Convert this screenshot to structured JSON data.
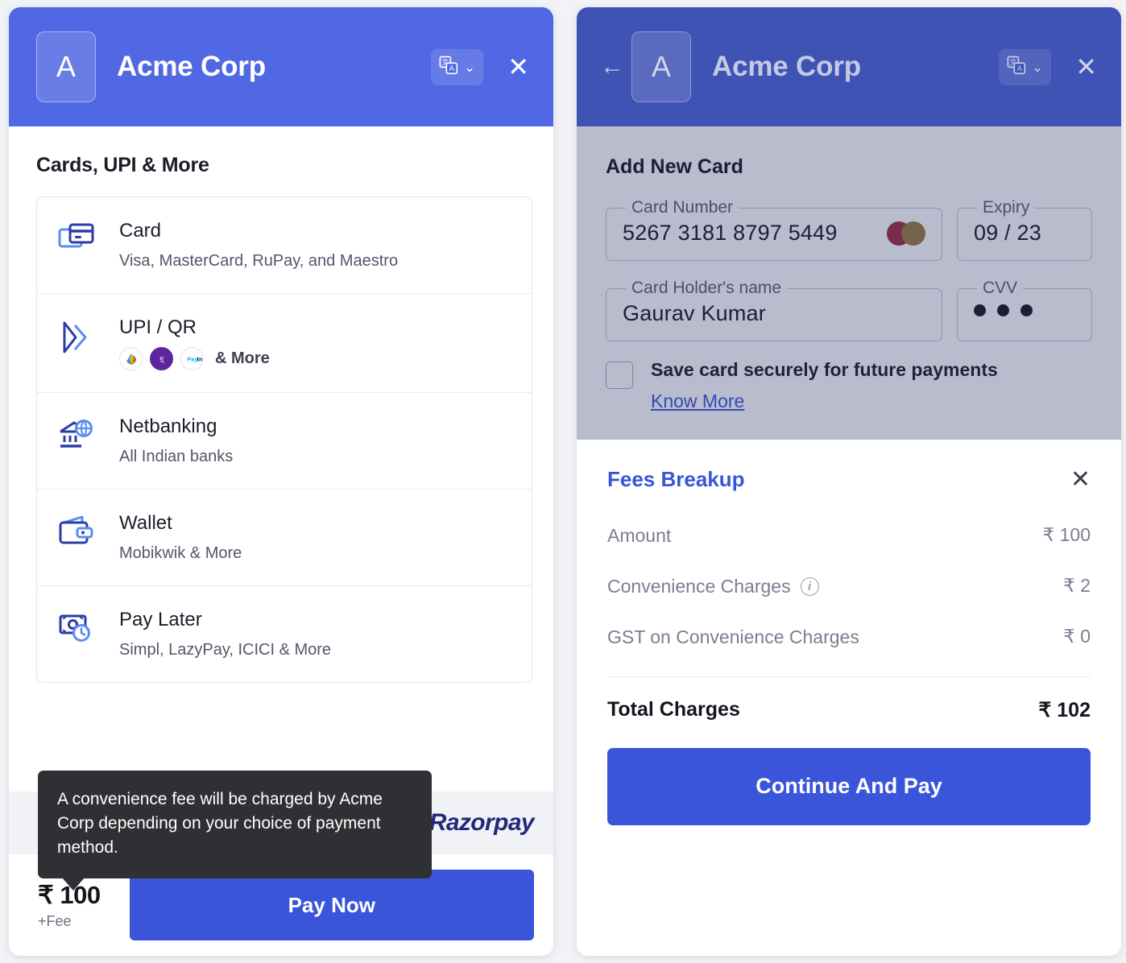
{
  "left": {
    "header": {
      "logo_letter": "A",
      "merchant": "Acme Corp",
      "lang_icon": "translate-icon",
      "chevron": "⌄",
      "close": "✕"
    },
    "section_title": "Cards, UPI & More",
    "methods": [
      {
        "icon": "credit-card-icon",
        "title": "Card",
        "subtitle": "Visa, MasterCard, RuPay, and Maestro"
      },
      {
        "icon": "upi-chevrons-icon",
        "title": "UPI / QR",
        "subtitle": "& More",
        "providers": [
          "google-pay",
          "phonepe",
          "paytm"
        ]
      },
      {
        "icon": "netbanking-bank-globe-icon",
        "title": "Netbanking",
        "subtitle": "All Indian banks"
      },
      {
        "icon": "wallet-icon",
        "title": "Wallet",
        "subtitle": "Mobikwik & More"
      },
      {
        "icon": "pay-later-clock-icon",
        "title": "Pay Later",
        "subtitle": "Simpl, LazyPay, ICICI & More"
      }
    ],
    "tooltip": "A convenience fee will be charged by Acme Corp depending on your choice of payment method.",
    "footer_brand": "Razorpay",
    "amount": "₹ 100",
    "amount_note": "+Fee",
    "pay_button": "Pay Now"
  },
  "right": {
    "header": {
      "back": "←",
      "logo_letter": "A",
      "merchant": "Acme Corp",
      "lang_icon": "translate-icon",
      "chevron": "⌄",
      "close": "✕"
    },
    "add_card_title": "Add New Card",
    "fields": {
      "card_number_label": "Card Number",
      "card_number_value": "5267 3181 8797 5449",
      "card_network": "mastercard",
      "expiry_label": "Expiry",
      "expiry_value": "09 / 23",
      "holder_label": "Card Holder's name",
      "holder_value": "Gaurav Kumar",
      "cvv_label": "CVV",
      "cvv_masked": "•••"
    },
    "save_card_label": "Save card securely for future payments",
    "know_more": "Know More",
    "fees": {
      "title": "Fees Breakup",
      "close": "✕",
      "rows": [
        {
          "label": "Amount",
          "value": "₹ 100",
          "info": false
        },
        {
          "label": "Convenience Charges",
          "value": "₹ 2",
          "info": true
        },
        {
          "label": "GST on Convenience Charges",
          "value": "₹ 0",
          "info": false
        }
      ],
      "total_label": "Total Charges",
      "total_value": "₹ 102"
    },
    "continue_button": "Continue And Pay"
  },
  "colors": {
    "header_blue": "#5168e4",
    "header_blue_dim": "#3f53b5",
    "accent": "#3a55d9",
    "icon_navy": "#2b3ba8",
    "icon_light_blue": "#5b8def",
    "tooltip_bg": "#2f3033",
    "muted_text": "#7a7f90"
  }
}
